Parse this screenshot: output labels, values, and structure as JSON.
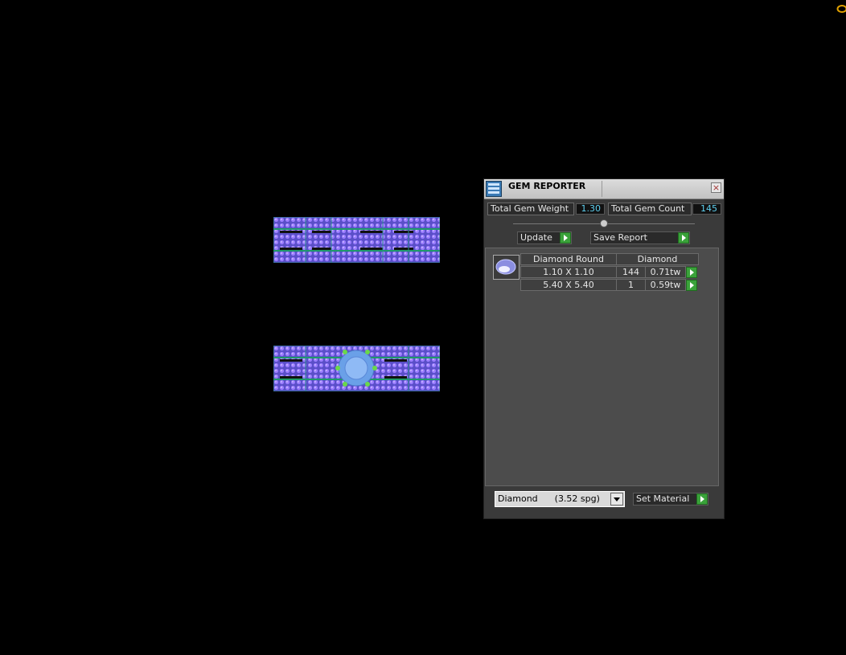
{
  "panel": {
    "title": "GEM REPORTER",
    "close_glyph": "×",
    "total_weight_label": "Total Gem Weight",
    "total_weight_value": "1.30",
    "total_count_label": "Total Gem Count",
    "total_count_value": "145",
    "update_label": "Update",
    "save_report_label": "Save Report",
    "table": {
      "header_shape": "Diamond Round",
      "header_material": "Diamond",
      "rows": [
        {
          "size": "1.10 X 1.10",
          "count": "144",
          "weight": "0.71tw"
        },
        {
          "size": "5.40 X 5.40",
          "count": "1",
          "weight": "0.59tw"
        }
      ]
    },
    "material_select": {
      "value": "Diamond      (3.52 spg)"
    },
    "set_material_label": "Set Material"
  },
  "icons": [
    "gem-reporter-icon",
    "close-icon",
    "go-arrow-icon",
    "gem-thumbnail-icon",
    "dropdown-arrow-icon",
    "ring-icon"
  ],
  "colors": {
    "accent_value": "#5fd0f0",
    "go_green": "#3aa23a",
    "gem_purple": "#7a5cff"
  }
}
